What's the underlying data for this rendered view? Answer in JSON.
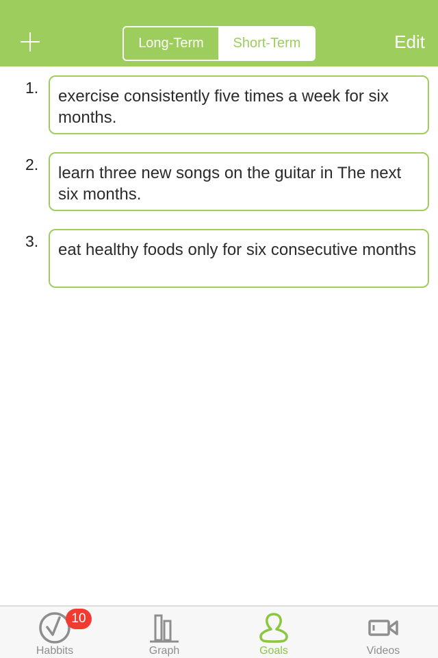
{
  "navbar": {
    "add_icon": "plus-icon",
    "segments": [
      {
        "label": "Long-Term",
        "selected": false
      },
      {
        "label": "Short-Term",
        "selected": true
      }
    ],
    "edit_label": "Edit"
  },
  "goals": [
    {
      "number": "1.",
      "text": "exercise consistently five times a week for six months."
    },
    {
      "number": "2.",
      "text": "learn three new songs on the guitar in The next six months."
    },
    {
      "number": "3.",
      "text": "eat healthy foods only for six consecutive months"
    }
  ],
  "tabbar": {
    "tabs": [
      {
        "label": "Habbits",
        "icon": "checkmark-circle-icon",
        "badge": "10",
        "active": false
      },
      {
        "label": "Graph",
        "icon": "bar-graph-icon",
        "active": false
      },
      {
        "label": "Goals",
        "icon": "person-icon",
        "active": true
      },
      {
        "label": "Videos",
        "icon": "video-camera-icon",
        "active": false
      }
    ]
  },
  "colors": {
    "accent": "#9dcd5c",
    "tab_active": "#8cc63f",
    "tab_inactive": "#8e8e8e",
    "badge": "#f23b30"
  }
}
